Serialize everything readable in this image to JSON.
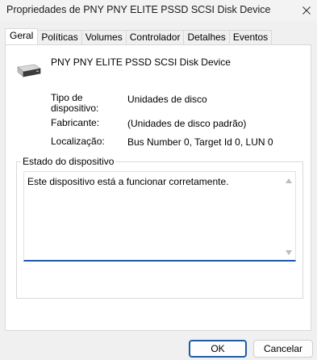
{
  "window": {
    "title": "Propriedades de PNY PNY ELITE PSSD SCSI Disk Device"
  },
  "tabs": [
    {
      "label": "Geral",
      "active": true
    },
    {
      "label": "Políticas",
      "active": false
    },
    {
      "label": "Volumes",
      "active": false
    },
    {
      "label": "Controlador",
      "active": false
    },
    {
      "label": "Detalhes",
      "active": false
    },
    {
      "label": "Eventos",
      "active": false
    }
  ],
  "general": {
    "device_icon": "disk-drive-icon",
    "device_name": "PNY PNY ELITE PSSD SCSI Disk Device",
    "type_label_line1": "Tipo de",
    "type_label_line2": "dispositivo:",
    "type_value": "Unidades de disco",
    "manufacturer_label": "Fabricante:",
    "manufacturer_value": "(Unidades de disco padrão)",
    "location_label": "Localização:",
    "location_value": "Bus Number 0, Target Id 0, LUN 0",
    "status_group_label": "Estado do dispositivo",
    "status_text": "Este dispositivo está a funcionar corretamente."
  },
  "buttons": {
    "ok": "OK",
    "cancel": "Cancelar"
  },
  "colors": {
    "accent": "#1e5aa8"
  }
}
